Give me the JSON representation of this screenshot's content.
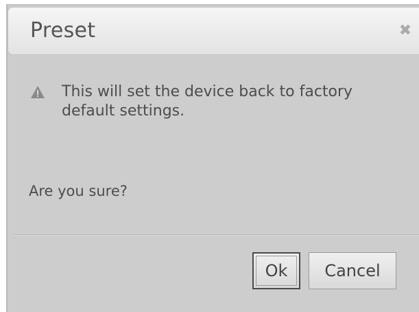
{
  "dialog": {
    "title": "Preset",
    "close_icon": "close-icon",
    "warning_icon": "warning-triangle-icon",
    "message": "This will set the device back to factory default settings.",
    "question": "Are you sure?",
    "ok_label": "Ok",
    "cancel_label": "Cancel"
  },
  "colors": {
    "dialog_background": "#cdcdcd",
    "titlebar": "#eeeeee",
    "text": "#4d4d4d"
  }
}
